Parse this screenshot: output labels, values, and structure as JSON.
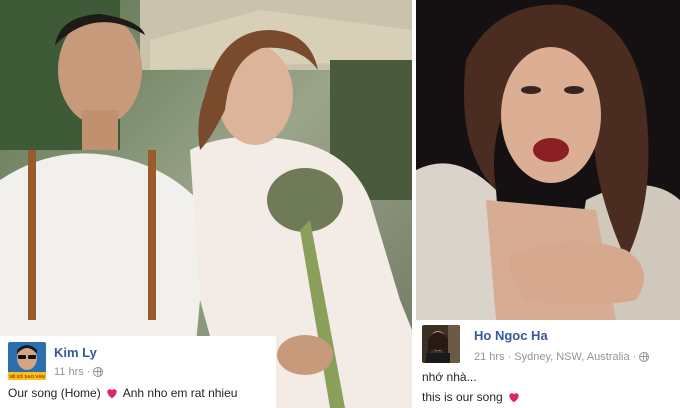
{
  "left_post": {
    "author": "Kim Ly",
    "time": "11 hrs",
    "separator": "·",
    "text_before": "Our song (Home)",
    "text_after": "Anh nho em rat nhieu",
    "avatar_caption": "VỀ SỐ SAO VĂN"
  },
  "right_post": {
    "author": "Ho Ngoc Ha",
    "time": "21 hrs",
    "separator": "·",
    "location": "Sydney, NSW, Australia",
    "line1": "nhớ nhà...",
    "line2": "this is our song"
  },
  "colors": {
    "author_link": "#365899",
    "meta": "#90949c",
    "heart": "#e0245e"
  },
  "icons": [
    "globe-icon",
    "heart-icon"
  ]
}
